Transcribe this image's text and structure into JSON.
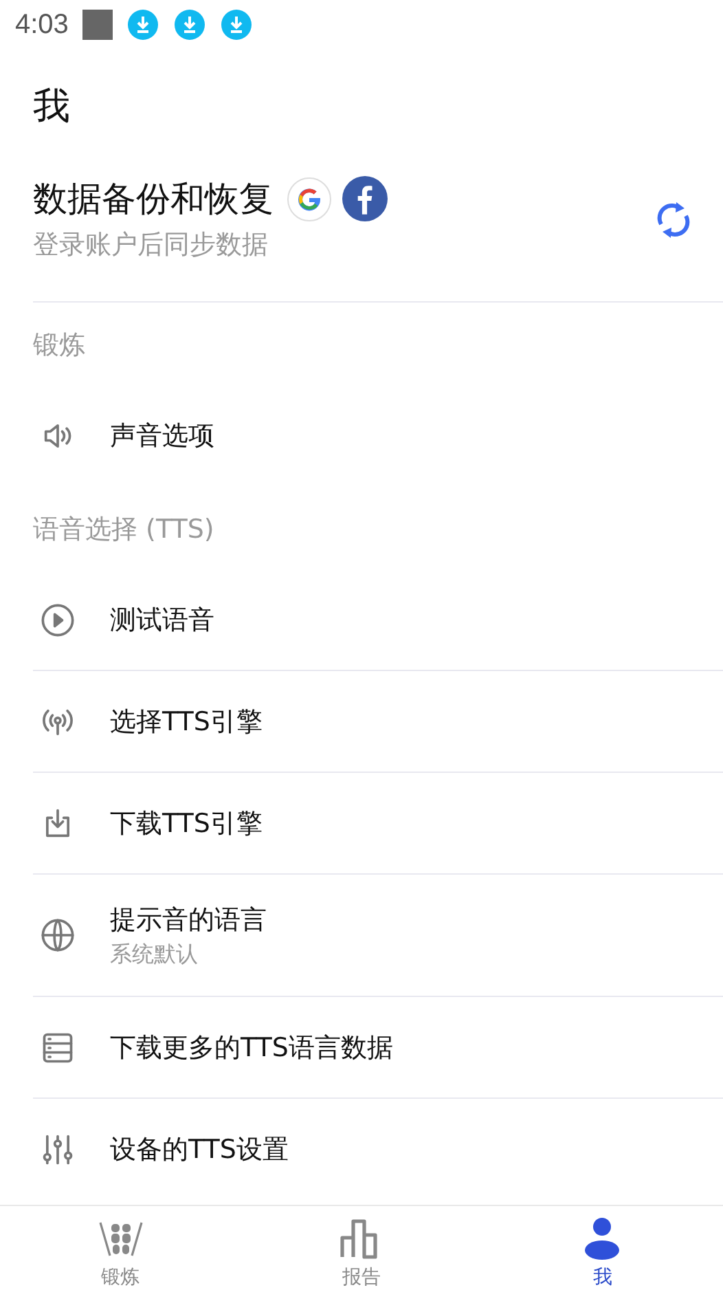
{
  "status_bar": {
    "time": "4:03"
  },
  "page_title": "我",
  "backup": {
    "title": "数据备份和恢复",
    "subtitle": "登录账户后同步数据"
  },
  "sections": [
    {
      "title": "锻炼",
      "items": [
        {
          "kind": "sound",
          "label": "声音选项"
        }
      ]
    },
    {
      "title": "语音选择 (TTS)",
      "items": [
        {
          "kind": "play",
          "label": "测试语音"
        },
        {
          "kind": "antenna",
          "label": "选择TTS引擎"
        },
        {
          "kind": "download",
          "label": "下载TTS引擎"
        },
        {
          "kind": "globe",
          "label": "提示音的语言",
          "sublabel": "系统默认"
        },
        {
          "kind": "storage",
          "label": "下载更多的TTS语言数据"
        },
        {
          "kind": "sliders",
          "label": "设备的TTS设置"
        }
      ]
    }
  ],
  "bottom_nav": [
    {
      "kind": "workout",
      "label": "锻炼",
      "selected": false
    },
    {
      "kind": "report",
      "label": "报告",
      "selected": false
    },
    {
      "kind": "me",
      "label": "我",
      "selected": true
    }
  ]
}
